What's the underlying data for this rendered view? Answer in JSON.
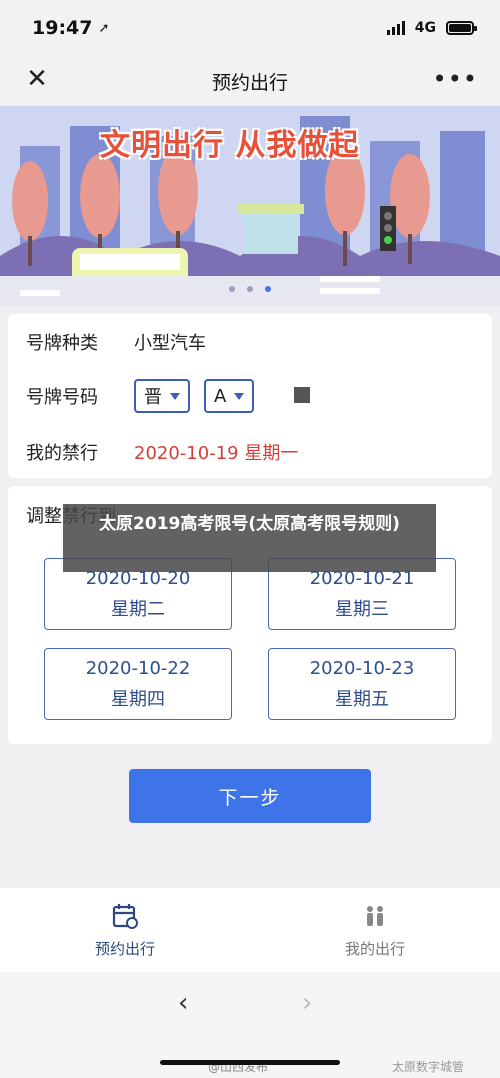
{
  "status_bar": {
    "time": "19:47",
    "network": "4G"
  },
  "nav": {
    "title": "预约出行"
  },
  "banner": {
    "slogan": "文明出行  从我做起"
  },
  "info": {
    "plate_type_label": "号牌种类",
    "plate_type_value": "小型汽车",
    "plate_no_label": "号牌号码",
    "province_value": "晋",
    "letter_value": "A",
    "restriction_label": "我的禁行",
    "restriction_value": "2020-10-19 星期一"
  },
  "adjust": {
    "title": "调整禁行到",
    "options": [
      {
        "date": "2020-10-20",
        "weekday": "星期二"
      },
      {
        "date": "2020-10-21",
        "weekday": "星期三"
      },
      {
        "date": "2020-10-22",
        "weekday": "星期四"
      },
      {
        "date": "2020-10-23",
        "weekday": "星期五"
      }
    ]
  },
  "next_label": "下一步",
  "tabs": [
    {
      "label": "预约出行",
      "icon": "calendar-icon"
    },
    {
      "label": "我的出行",
      "icon": "people-icon"
    }
  ],
  "overlay": {
    "text": "太原2019高考限号(太原高考限号规则)"
  },
  "watermark": {
    "left": "@山西发布",
    "right": "太原数字城管"
  },
  "colors": {
    "accent": "#3f73e8",
    "border": "#4b6ab5",
    "alert": "#d43f3a"
  }
}
